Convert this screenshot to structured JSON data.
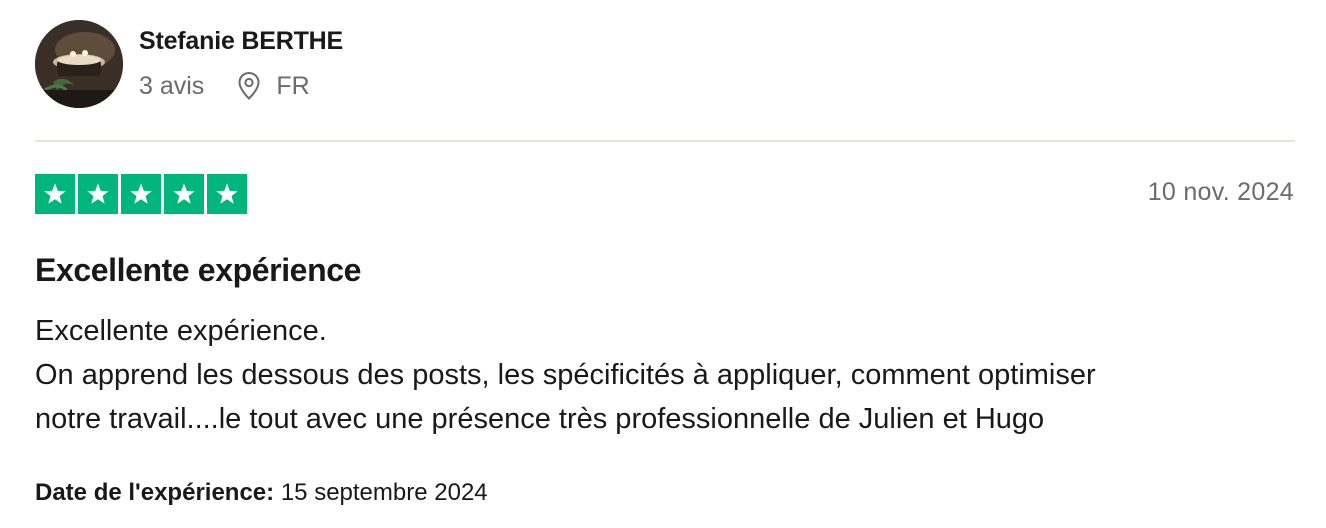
{
  "reviewer": {
    "name": "Stefanie BERTHE",
    "review_count": "3 avis",
    "country": "FR",
    "location_icon": "location-pin-icon"
  },
  "review": {
    "rating": 5,
    "rating_max": 5,
    "star_color": "#00b67a",
    "date": "10 nov. 2024",
    "title": "Excellente expérience",
    "body_lines": [
      "Excellente expérience.",
      "On apprend les dessous des posts, les spécificités à appliquer, comment optimiser",
      "notre travail....le tout avec une présence très professionnelle de Julien et Hugo"
    ],
    "experience_label": "Date de l'expérience:",
    "experience_date": "15 septembre 2024"
  }
}
